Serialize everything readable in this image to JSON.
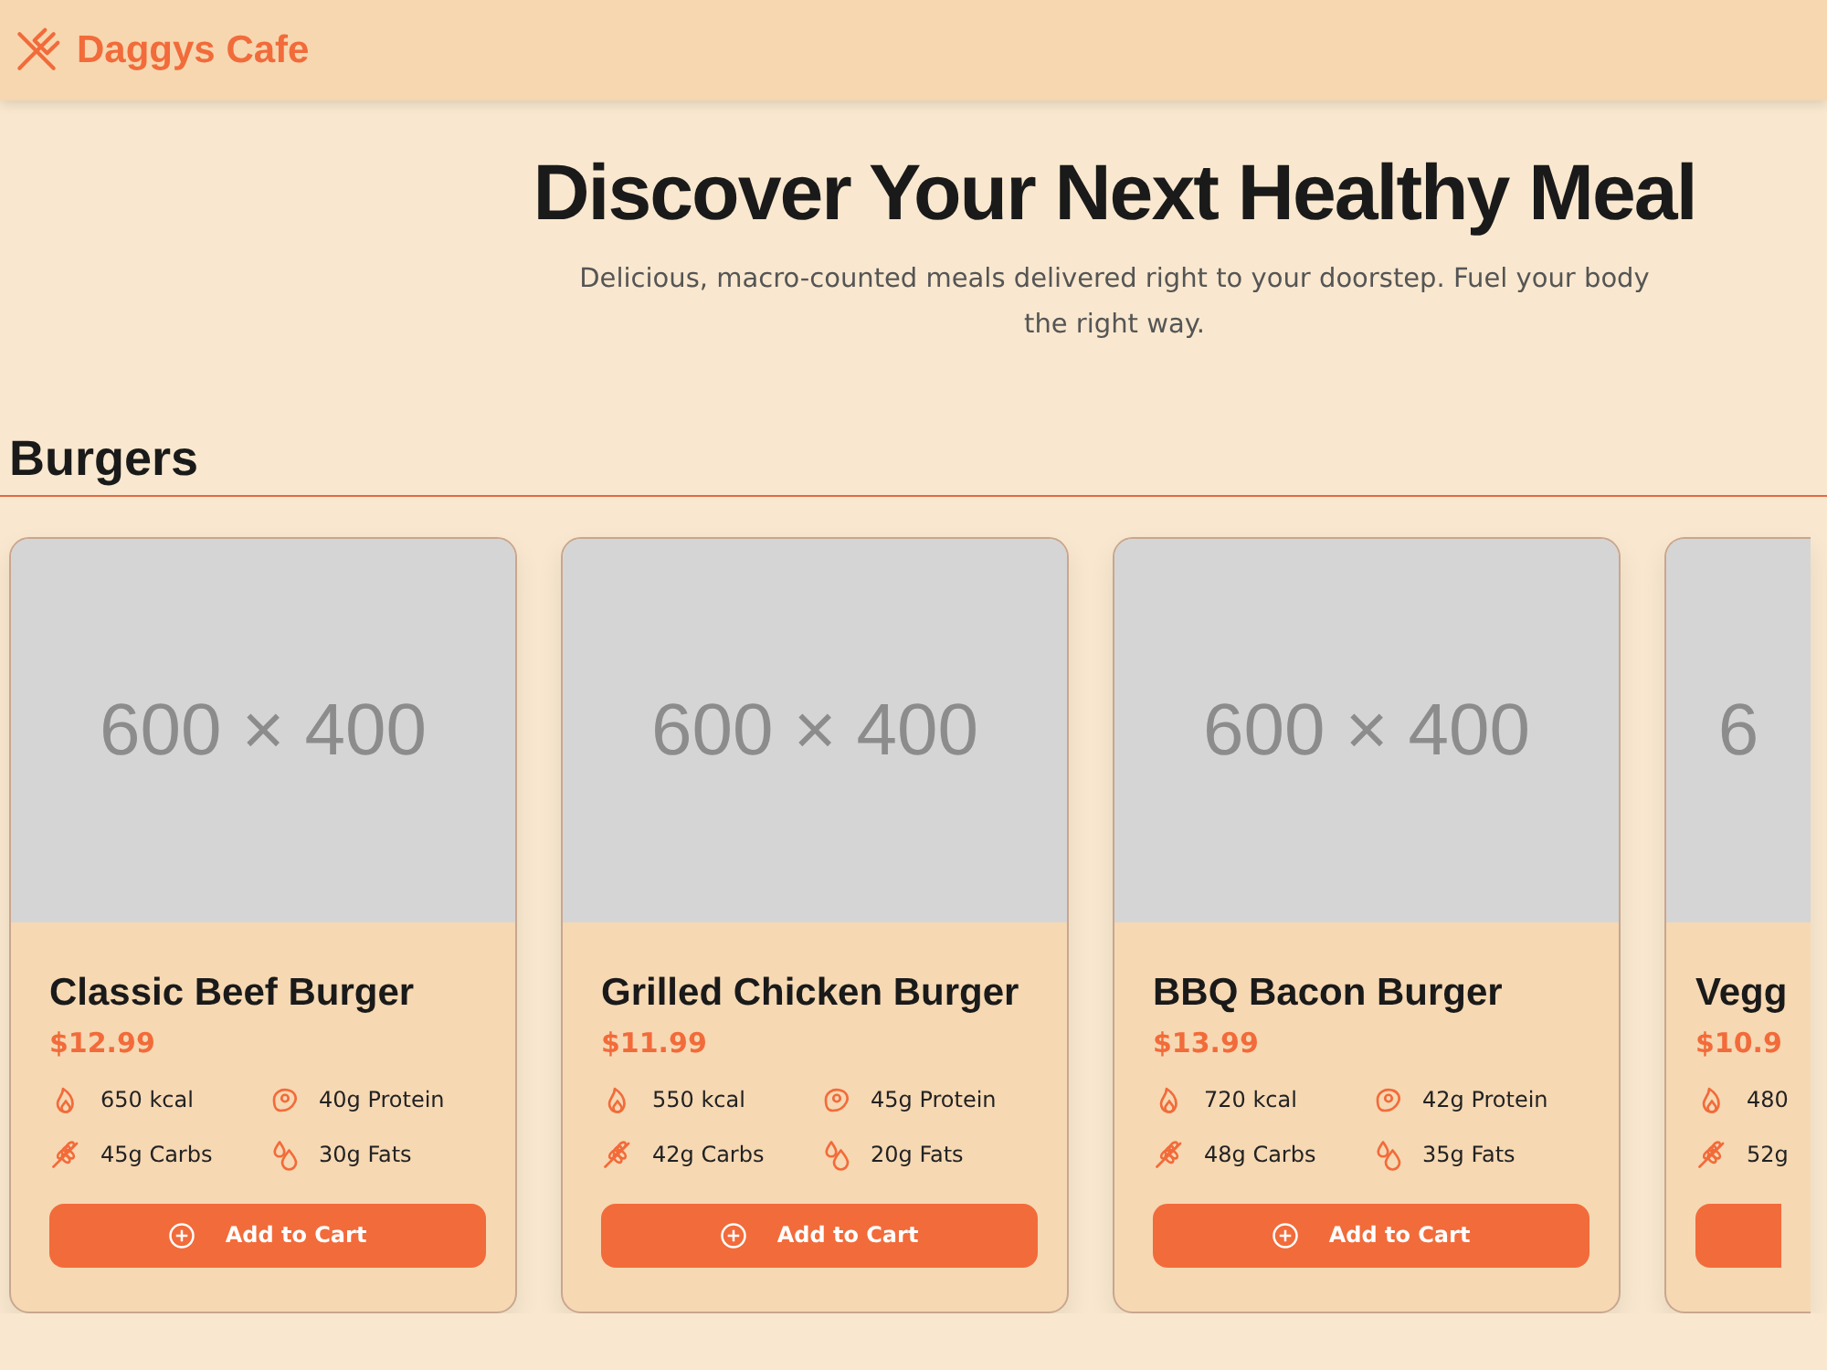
{
  "brand": "Daggys Cafe",
  "hero": {
    "title": "Discover Your Next Healthy Meal",
    "subtitle": "Delicious, macro-counted meals delivered right to your doorstep. Fuel your body the right way."
  },
  "section": {
    "title": "Burgers"
  },
  "cards": [
    {
      "image_text": "600 × 400",
      "name": "Classic Beef Burger",
      "price": "$12.99",
      "macros": [
        {
          "kind": "kcal",
          "text": "650 kcal"
        },
        {
          "kind": "protein",
          "text": "40g Protein"
        },
        {
          "kind": "carbs",
          "text": "45g Carbs"
        },
        {
          "kind": "fats",
          "text": "30g Fats"
        }
      ],
      "button": "Add to Cart"
    },
    {
      "image_text": "600 × 400",
      "name": "Grilled Chicken Burger",
      "price": "$11.99",
      "macros": [
        {
          "kind": "kcal",
          "text": "550 kcal"
        },
        {
          "kind": "protein",
          "text": "45g Protein"
        },
        {
          "kind": "carbs",
          "text": "42g Carbs"
        },
        {
          "kind": "fats",
          "text": "20g Fats"
        }
      ],
      "button": "Add to Cart"
    },
    {
      "image_text": "600 × 400",
      "name": "BBQ Bacon Burger",
      "price": "$13.99",
      "macros": [
        {
          "kind": "kcal",
          "text": "720 kcal"
        },
        {
          "kind": "protein",
          "text": "42g Protein"
        },
        {
          "kind": "carbs",
          "text": "48g Carbs"
        },
        {
          "kind": "fats",
          "text": "35g Fats"
        }
      ],
      "button": "Add to Cart"
    },
    {
      "image_text": "6",
      "name": "Vegg",
      "price": "$10.9",
      "macros": [
        {
          "kind": "kcal",
          "text": "480"
        },
        {
          "kind": "carbs",
          "text": "52g"
        }
      ]
    }
  ]
}
